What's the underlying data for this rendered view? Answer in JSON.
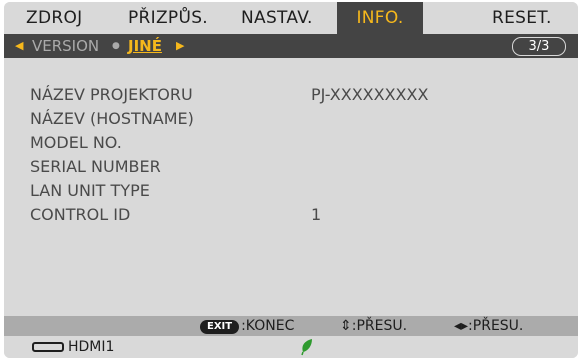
{
  "tabs": [
    {
      "label": "ZDROJ",
      "active": false
    },
    {
      "label": "PŘIZPŮS.",
      "active": false
    },
    {
      "label": "NASTAV.",
      "active": false
    },
    {
      "label": "INFO.",
      "active": true
    },
    {
      "label": "RESET.",
      "active": false
    }
  ],
  "subtabs": {
    "prev_arrow": "◀",
    "version": "VERSION",
    "separator": "●",
    "current": "JINÉ",
    "next_arrow": "▶",
    "page": "3/3"
  },
  "rows": [
    {
      "label": "NÁZEV PROJEKTORU",
      "value": "PJ-XXXXXXXXX"
    },
    {
      "label": "NÁZEV (HOSTNAME)",
      "value": ""
    },
    {
      "label": "MODEL NO.",
      "value": ""
    },
    {
      "label": "SERIAL NUMBER",
      "value": ""
    },
    {
      "label": "LAN UNIT TYPE",
      "value": ""
    },
    {
      "label": "CONTROL ID",
      "value": "1"
    }
  ],
  "guide": {
    "exit_key": "EXIT",
    "exit_label": ":KONEC",
    "updown_label": "⇕:PŘESU.",
    "leftright_label": "◂▸:PŘESU."
  },
  "status": {
    "source_icon": "hdmi-port-icon",
    "source": "HDMI1",
    "eco_icon": "eco-leaf-icon"
  },
  "colors": {
    "accent": "#f6b81c",
    "panel": "#d9d9d9",
    "dark_bar": "#444444",
    "guide_bar": "#ababab",
    "leaf": "#2e9a2e"
  }
}
